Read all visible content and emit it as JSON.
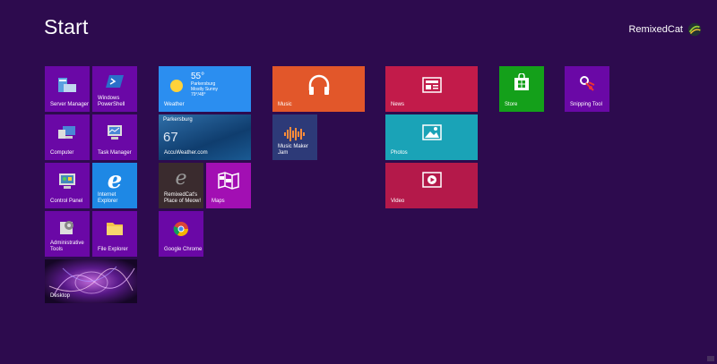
{
  "header": {
    "title": "Start",
    "user_name": "RemixedCat"
  },
  "tiles": {
    "server_manager": "Server Manager",
    "windows_powershell": "Windows\nPowerShell",
    "computer": "Computer",
    "task_manager": "Task Manager",
    "control_panel": "Control Panel",
    "internet_explorer": "Internet Explorer",
    "admin_tools": "Administrative\nTools",
    "file_explorer": "File Explorer",
    "desktop": "Desktop",
    "weather": {
      "label": "Weather",
      "temp": "55°",
      "city": "Parkersburg",
      "cond": "Mostly Sunny",
      "range": "79°/48°"
    },
    "accuweather": {
      "label": "AccuWeather.com",
      "city": "Parkersburg",
      "temp": "67"
    },
    "remixedcat": "RemixedCat's\nPlace of Meow!",
    "maps": "Maps",
    "chrome": "Google Chrome",
    "music": "Music",
    "music_maker_jam": "Music Maker Jam",
    "news": "News",
    "photos": "Photos",
    "video": "Video",
    "store": "Store",
    "snipping_tool": "Snipping Tool"
  }
}
